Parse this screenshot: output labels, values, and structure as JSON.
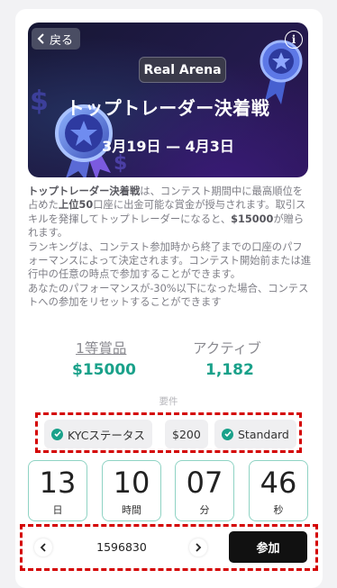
{
  "banner": {
    "back_label": "戻る",
    "info_label": "i",
    "badge": "Real Arena",
    "title": "トップトレーダー決着戦",
    "dates": "3月19日 — 4月3日"
  },
  "description": {
    "p1_a": "トップトレーダー決着戦",
    "p1_b": "は、コンテスト期間中に最高順位を占めた",
    "p1_c": "上位50",
    "p1_d": "口座に出金可能な賞金が授与されます。取引スキルを発揮してトップトレーダーになると、",
    "p1_e": "$15000",
    "p1_f": "が贈られます。",
    "p2": "ランキングは、コンテスト参加時から終了までの口座のパフォーマンスによって決定されます。コンテスト開始前または進行中の任意の時点で参加することができます。",
    "p3": "あなたのパフォーマンスが-30%以下になった場合、コンテストへの参加をリセットすることができます"
  },
  "stats": {
    "prize_label": "1等賞品",
    "prize_value": "$15000",
    "active_label": "アクティブ",
    "active_value": "1,182"
  },
  "requirements": {
    "label": "要件",
    "items": [
      "KYCステータス",
      "$200",
      "Standard"
    ]
  },
  "countdown": [
    {
      "value": "13",
      "unit": "日"
    },
    {
      "value": "10",
      "unit": "時間"
    },
    {
      "value": "07",
      "unit": "分"
    },
    {
      "value": "46",
      "unit": "秒"
    }
  ],
  "footer": {
    "account_number": "1596830",
    "join_label": "参加"
  },
  "colors": {
    "accent": "#1aa18a",
    "highlight_border": "#d40000",
    "button_dark": "#111111"
  }
}
